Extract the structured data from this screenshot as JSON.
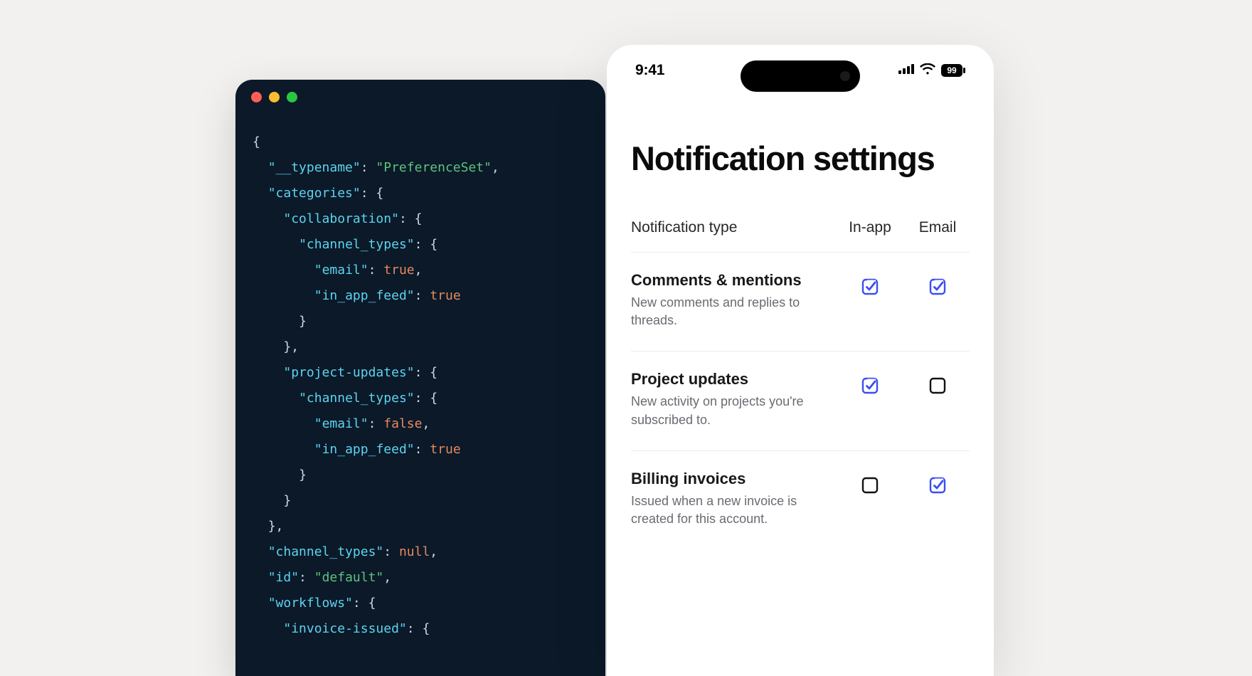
{
  "code": {
    "json_text": "{\n  \"__typename\": \"PreferenceSet\",\n  \"categories\": {\n    \"collaboration\": {\n      \"channel_types\": {\n        \"email\": true,\n        \"in_app_feed\": true\n      }\n    },\n    \"project-updates\": {\n      \"channel_types\": {\n        \"email\": false,\n        \"in_app_feed\": true\n      }\n    }\n  },\n  \"channel_types\": null,\n  \"id\": \"default\",\n  \"workflows\": {\n    \"invoice-issued\": {"
  },
  "phone": {
    "status": {
      "time": "9:41",
      "battery": "99"
    },
    "title": "Notification settings",
    "columns": {
      "type": "Notification type",
      "in_app": "In-app",
      "email": "Email"
    },
    "rows": [
      {
        "title": "Comments & mentions",
        "desc": "New comments and replies to threads.",
        "in_app": true,
        "email": true
      },
      {
        "title": "Project updates",
        "desc": "New activity on projects you're subscribed to.",
        "in_app": true,
        "email": false
      },
      {
        "title": "Billing invoices",
        "desc": "Issued when a new invoice is created for this account.",
        "in_app": false,
        "email": true
      }
    ]
  },
  "colors": {
    "accent": "#3b4ef0"
  }
}
